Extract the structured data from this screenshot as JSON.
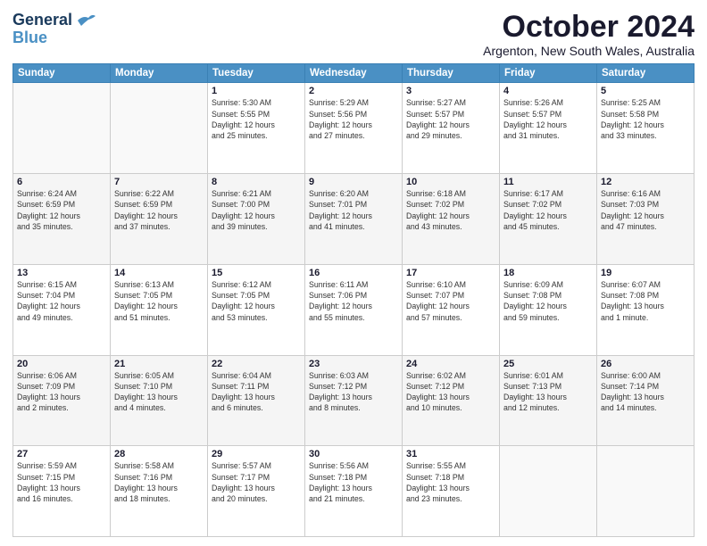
{
  "logo": {
    "line1": "General",
    "line2": "Blue"
  },
  "title": "October 2024",
  "location": "Argenton, New South Wales, Australia",
  "weekdays": [
    "Sunday",
    "Monday",
    "Tuesday",
    "Wednesday",
    "Thursday",
    "Friday",
    "Saturday"
  ],
  "weeks": [
    [
      {
        "day": "",
        "info": ""
      },
      {
        "day": "",
        "info": ""
      },
      {
        "day": "1",
        "info": "Sunrise: 5:30 AM\nSunset: 5:55 PM\nDaylight: 12 hours\nand 25 minutes."
      },
      {
        "day": "2",
        "info": "Sunrise: 5:29 AM\nSunset: 5:56 PM\nDaylight: 12 hours\nand 27 minutes."
      },
      {
        "day": "3",
        "info": "Sunrise: 5:27 AM\nSunset: 5:57 PM\nDaylight: 12 hours\nand 29 minutes."
      },
      {
        "day": "4",
        "info": "Sunrise: 5:26 AM\nSunset: 5:57 PM\nDaylight: 12 hours\nand 31 minutes."
      },
      {
        "day": "5",
        "info": "Sunrise: 5:25 AM\nSunset: 5:58 PM\nDaylight: 12 hours\nand 33 minutes."
      }
    ],
    [
      {
        "day": "6",
        "info": "Sunrise: 6:24 AM\nSunset: 6:59 PM\nDaylight: 12 hours\nand 35 minutes."
      },
      {
        "day": "7",
        "info": "Sunrise: 6:22 AM\nSunset: 6:59 PM\nDaylight: 12 hours\nand 37 minutes."
      },
      {
        "day": "8",
        "info": "Sunrise: 6:21 AM\nSunset: 7:00 PM\nDaylight: 12 hours\nand 39 minutes."
      },
      {
        "day": "9",
        "info": "Sunrise: 6:20 AM\nSunset: 7:01 PM\nDaylight: 12 hours\nand 41 minutes."
      },
      {
        "day": "10",
        "info": "Sunrise: 6:18 AM\nSunset: 7:02 PM\nDaylight: 12 hours\nand 43 minutes."
      },
      {
        "day": "11",
        "info": "Sunrise: 6:17 AM\nSunset: 7:02 PM\nDaylight: 12 hours\nand 45 minutes."
      },
      {
        "day": "12",
        "info": "Sunrise: 6:16 AM\nSunset: 7:03 PM\nDaylight: 12 hours\nand 47 minutes."
      }
    ],
    [
      {
        "day": "13",
        "info": "Sunrise: 6:15 AM\nSunset: 7:04 PM\nDaylight: 12 hours\nand 49 minutes."
      },
      {
        "day": "14",
        "info": "Sunrise: 6:13 AM\nSunset: 7:05 PM\nDaylight: 12 hours\nand 51 minutes."
      },
      {
        "day": "15",
        "info": "Sunrise: 6:12 AM\nSunset: 7:05 PM\nDaylight: 12 hours\nand 53 minutes."
      },
      {
        "day": "16",
        "info": "Sunrise: 6:11 AM\nSunset: 7:06 PM\nDaylight: 12 hours\nand 55 minutes."
      },
      {
        "day": "17",
        "info": "Sunrise: 6:10 AM\nSunset: 7:07 PM\nDaylight: 12 hours\nand 57 minutes."
      },
      {
        "day": "18",
        "info": "Sunrise: 6:09 AM\nSunset: 7:08 PM\nDaylight: 12 hours\nand 59 minutes."
      },
      {
        "day": "19",
        "info": "Sunrise: 6:07 AM\nSunset: 7:08 PM\nDaylight: 13 hours\nand 1 minute."
      }
    ],
    [
      {
        "day": "20",
        "info": "Sunrise: 6:06 AM\nSunset: 7:09 PM\nDaylight: 13 hours\nand 2 minutes."
      },
      {
        "day": "21",
        "info": "Sunrise: 6:05 AM\nSunset: 7:10 PM\nDaylight: 13 hours\nand 4 minutes."
      },
      {
        "day": "22",
        "info": "Sunrise: 6:04 AM\nSunset: 7:11 PM\nDaylight: 13 hours\nand 6 minutes."
      },
      {
        "day": "23",
        "info": "Sunrise: 6:03 AM\nSunset: 7:12 PM\nDaylight: 13 hours\nand 8 minutes."
      },
      {
        "day": "24",
        "info": "Sunrise: 6:02 AM\nSunset: 7:12 PM\nDaylight: 13 hours\nand 10 minutes."
      },
      {
        "day": "25",
        "info": "Sunrise: 6:01 AM\nSunset: 7:13 PM\nDaylight: 13 hours\nand 12 minutes."
      },
      {
        "day": "26",
        "info": "Sunrise: 6:00 AM\nSunset: 7:14 PM\nDaylight: 13 hours\nand 14 minutes."
      }
    ],
    [
      {
        "day": "27",
        "info": "Sunrise: 5:59 AM\nSunset: 7:15 PM\nDaylight: 13 hours\nand 16 minutes."
      },
      {
        "day": "28",
        "info": "Sunrise: 5:58 AM\nSunset: 7:16 PM\nDaylight: 13 hours\nand 18 minutes."
      },
      {
        "day": "29",
        "info": "Sunrise: 5:57 AM\nSunset: 7:17 PM\nDaylight: 13 hours\nand 20 minutes."
      },
      {
        "day": "30",
        "info": "Sunrise: 5:56 AM\nSunset: 7:18 PM\nDaylight: 13 hours\nand 21 minutes."
      },
      {
        "day": "31",
        "info": "Sunrise: 5:55 AM\nSunset: 7:18 PM\nDaylight: 13 hours\nand 23 minutes."
      },
      {
        "day": "",
        "info": ""
      },
      {
        "day": "",
        "info": ""
      }
    ]
  ]
}
